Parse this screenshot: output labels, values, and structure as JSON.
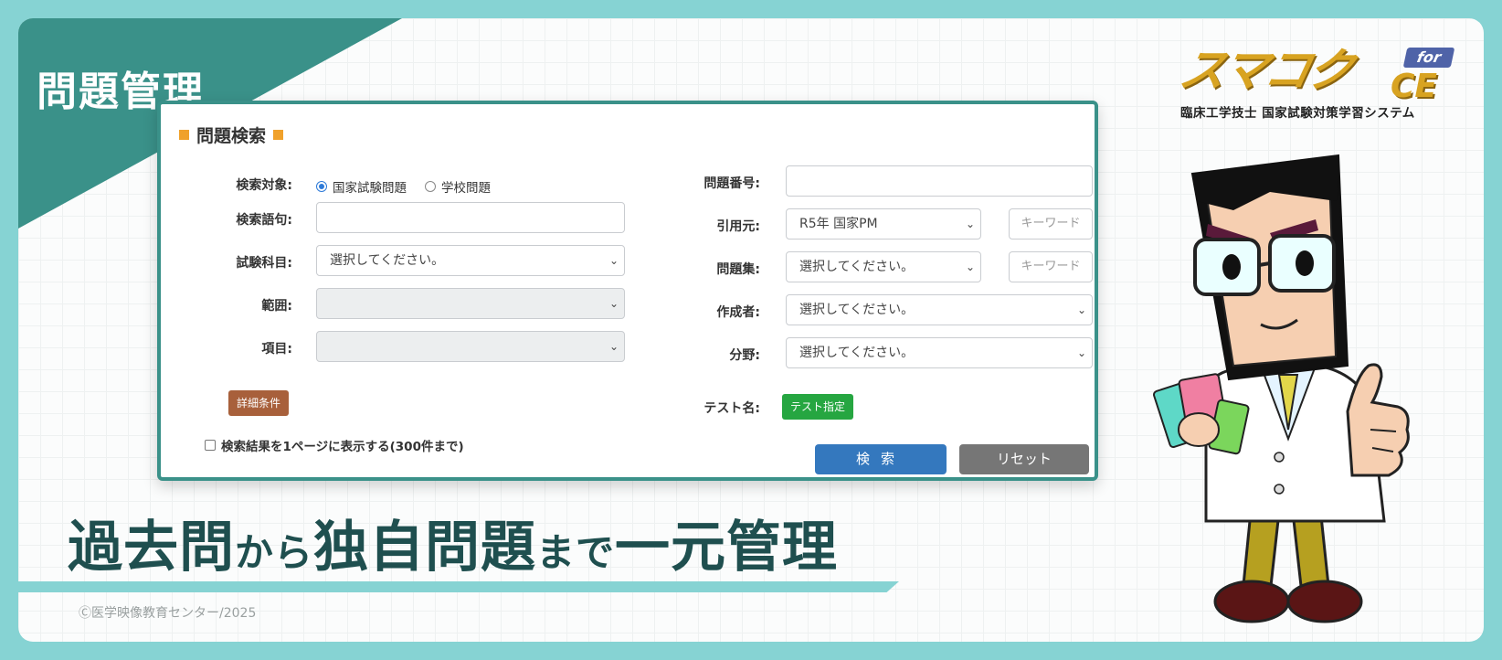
{
  "banner": {
    "label": "問題管理",
    "headline_parts": [
      "過去問",
      "から",
      "独自問題",
      "まで",
      "一元管理"
    ],
    "copyright": "Ⓒ医学映像教育センター/2025"
  },
  "logo": {
    "main": "スマコク",
    "suffix": "CE",
    "for_badge": "for",
    "subtitle": "臨床工学技士 国家試験対策学習システム"
  },
  "search_panel": {
    "title": "問題検索",
    "target": {
      "label": "検索対象:",
      "options": [
        "国家試験問題",
        "学校問題"
      ],
      "selected": "国家試験問題"
    },
    "query": {
      "label": "検索語句:",
      "value": ""
    },
    "subject": {
      "label": "試験科目:",
      "value": "選択してください。"
    },
    "range": {
      "label": "範囲:",
      "value": ""
    },
    "item": {
      "label": "項目:",
      "value": ""
    },
    "detail_button": "詳細条件",
    "one_page_checkbox": "検索結果を1ページに表示する(300件まで)",
    "problem_number": {
      "label": "問題番号:",
      "value": ""
    },
    "citation": {
      "label": "引用元:",
      "value": "R5年 国家PM",
      "keyword_placeholder": "キーワード"
    },
    "collection": {
      "label": "問題集:",
      "value": "選択してください。",
      "keyword_placeholder": "キーワード"
    },
    "author": {
      "label": "作成者:",
      "value": "選択してください。"
    },
    "field": {
      "label": "分野:",
      "value": "選択してください。"
    },
    "test_name": {
      "label": "テスト名:",
      "button": "テスト指定"
    },
    "search_button": "検索",
    "reset_button": "リセット"
  },
  "colors": {
    "teal": "#3a9189",
    "teal_light": "#86d3d3",
    "orange": "#f0a12b",
    "brown_button": "#a8603b",
    "green_button": "#26a641",
    "blue_button": "#3478be",
    "gray_button": "#767676",
    "logo_gold": "#d8a321",
    "headline": "#1f4f4f"
  }
}
